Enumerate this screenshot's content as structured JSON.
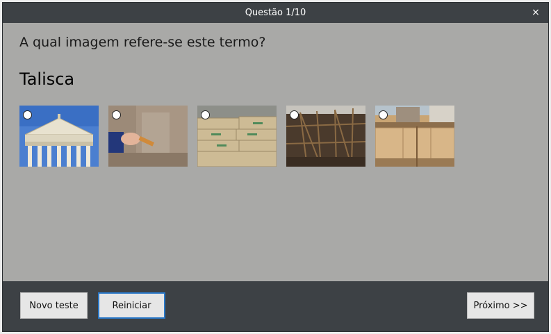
{
  "dialog": {
    "title": "Questão 1/10",
    "close_label": "×"
  },
  "question": {
    "prompt": "A qual imagem refere-se este termo?",
    "term": "Talisca"
  },
  "options": [
    {
      "name": "option-greek-temple"
    },
    {
      "name": "option-hand-wall-sample"
    },
    {
      "name": "option-cement-bags"
    },
    {
      "name": "option-steel-scaffold"
    },
    {
      "name": "option-excavation-shoring"
    }
  ],
  "footer": {
    "new_test_label": "Novo teste",
    "restart_label": "Reiniciar",
    "next_label": "Próximo >>"
  },
  "colors": {
    "titlebar": "#3d4145",
    "body": "#a9a9a7",
    "focus_border": "#2a78c8"
  }
}
